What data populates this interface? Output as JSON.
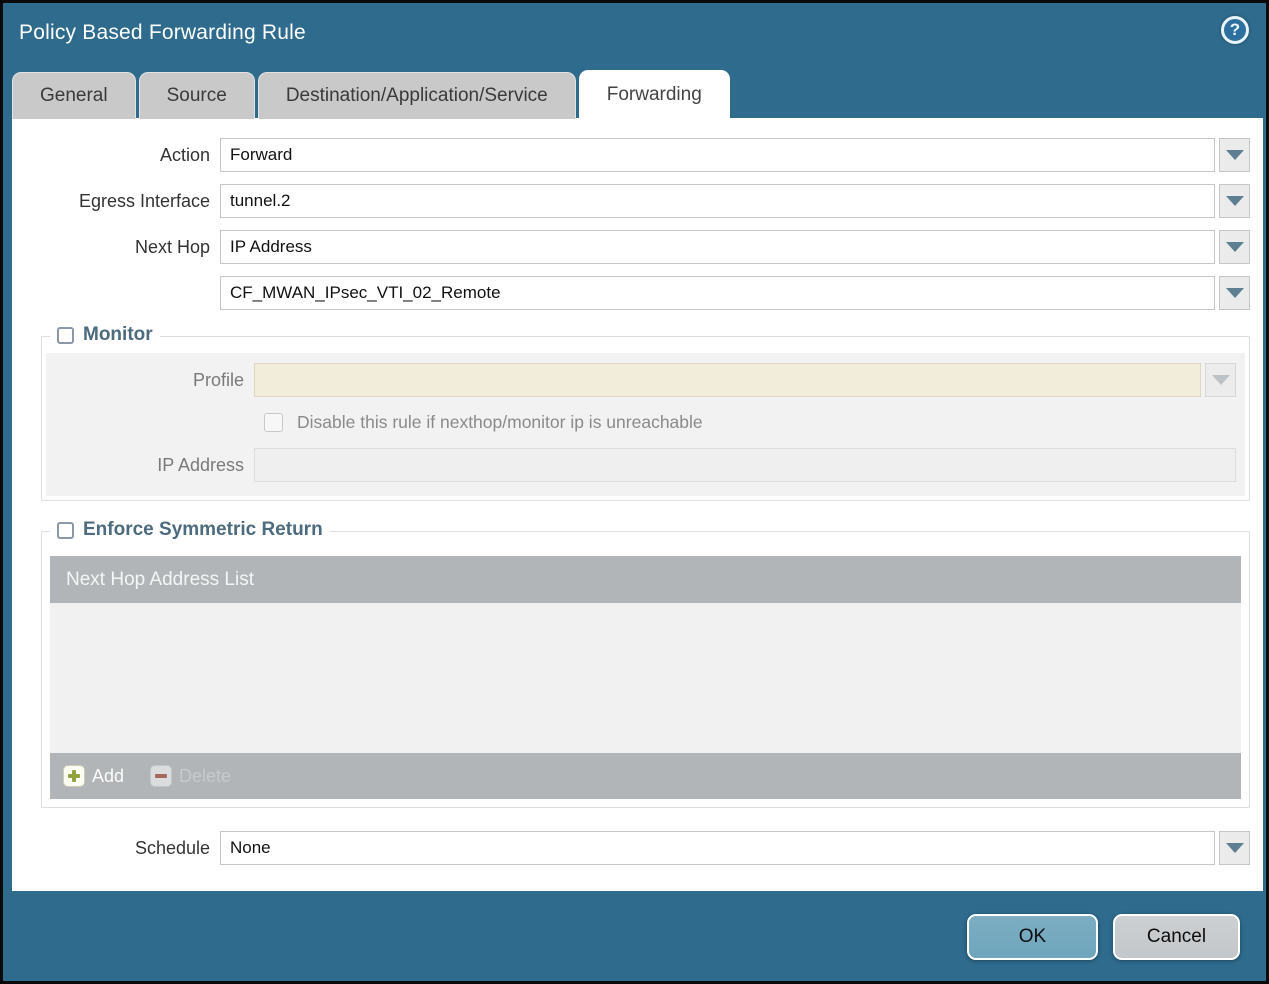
{
  "titlebar": {
    "title": "Policy Based Forwarding Rule"
  },
  "tabs": [
    {
      "label": "General",
      "active": false
    },
    {
      "label": "Source",
      "active": false
    },
    {
      "label": "Destination/Application/Service",
      "active": false
    },
    {
      "label": "Forwarding",
      "active": true
    }
  ],
  "form": {
    "action": {
      "label": "Action",
      "value": "Forward"
    },
    "egress_interface": {
      "label": "Egress Interface",
      "value": "tunnel.2"
    },
    "next_hop": {
      "label": "Next Hop",
      "value": "IP Address"
    },
    "next_hop_address": {
      "value": "CF_MWAN_IPsec_VTI_02_Remote"
    },
    "schedule": {
      "label": "Schedule",
      "value": "None"
    }
  },
  "monitor": {
    "legend": "Monitor",
    "checked": false,
    "profile": {
      "label": "Profile",
      "value": ""
    },
    "disable_rule": {
      "label": "Disable this rule if nexthop/monitor ip is unreachable",
      "checked": false
    },
    "ip_address": {
      "label": "IP Address",
      "value": ""
    }
  },
  "enforce_symmetric_return": {
    "legend": "Enforce Symmetric Return",
    "checked": false,
    "table": {
      "header": "Next Hop Address List",
      "rows": []
    },
    "toolbar": {
      "add_label": "Add",
      "delete_label": "Delete"
    }
  },
  "footer_buttons": {
    "ok": "OK",
    "cancel": "Cancel"
  },
  "colors": {
    "titlebar_teal": "#2E6B8D",
    "legend_text": "#4C6B7E",
    "table_gray": "#B1B5B7",
    "disabled_beige": "#F2EDDA",
    "ok_button": "#6FA6BC",
    "cancel_button": "#C4C7C9"
  }
}
